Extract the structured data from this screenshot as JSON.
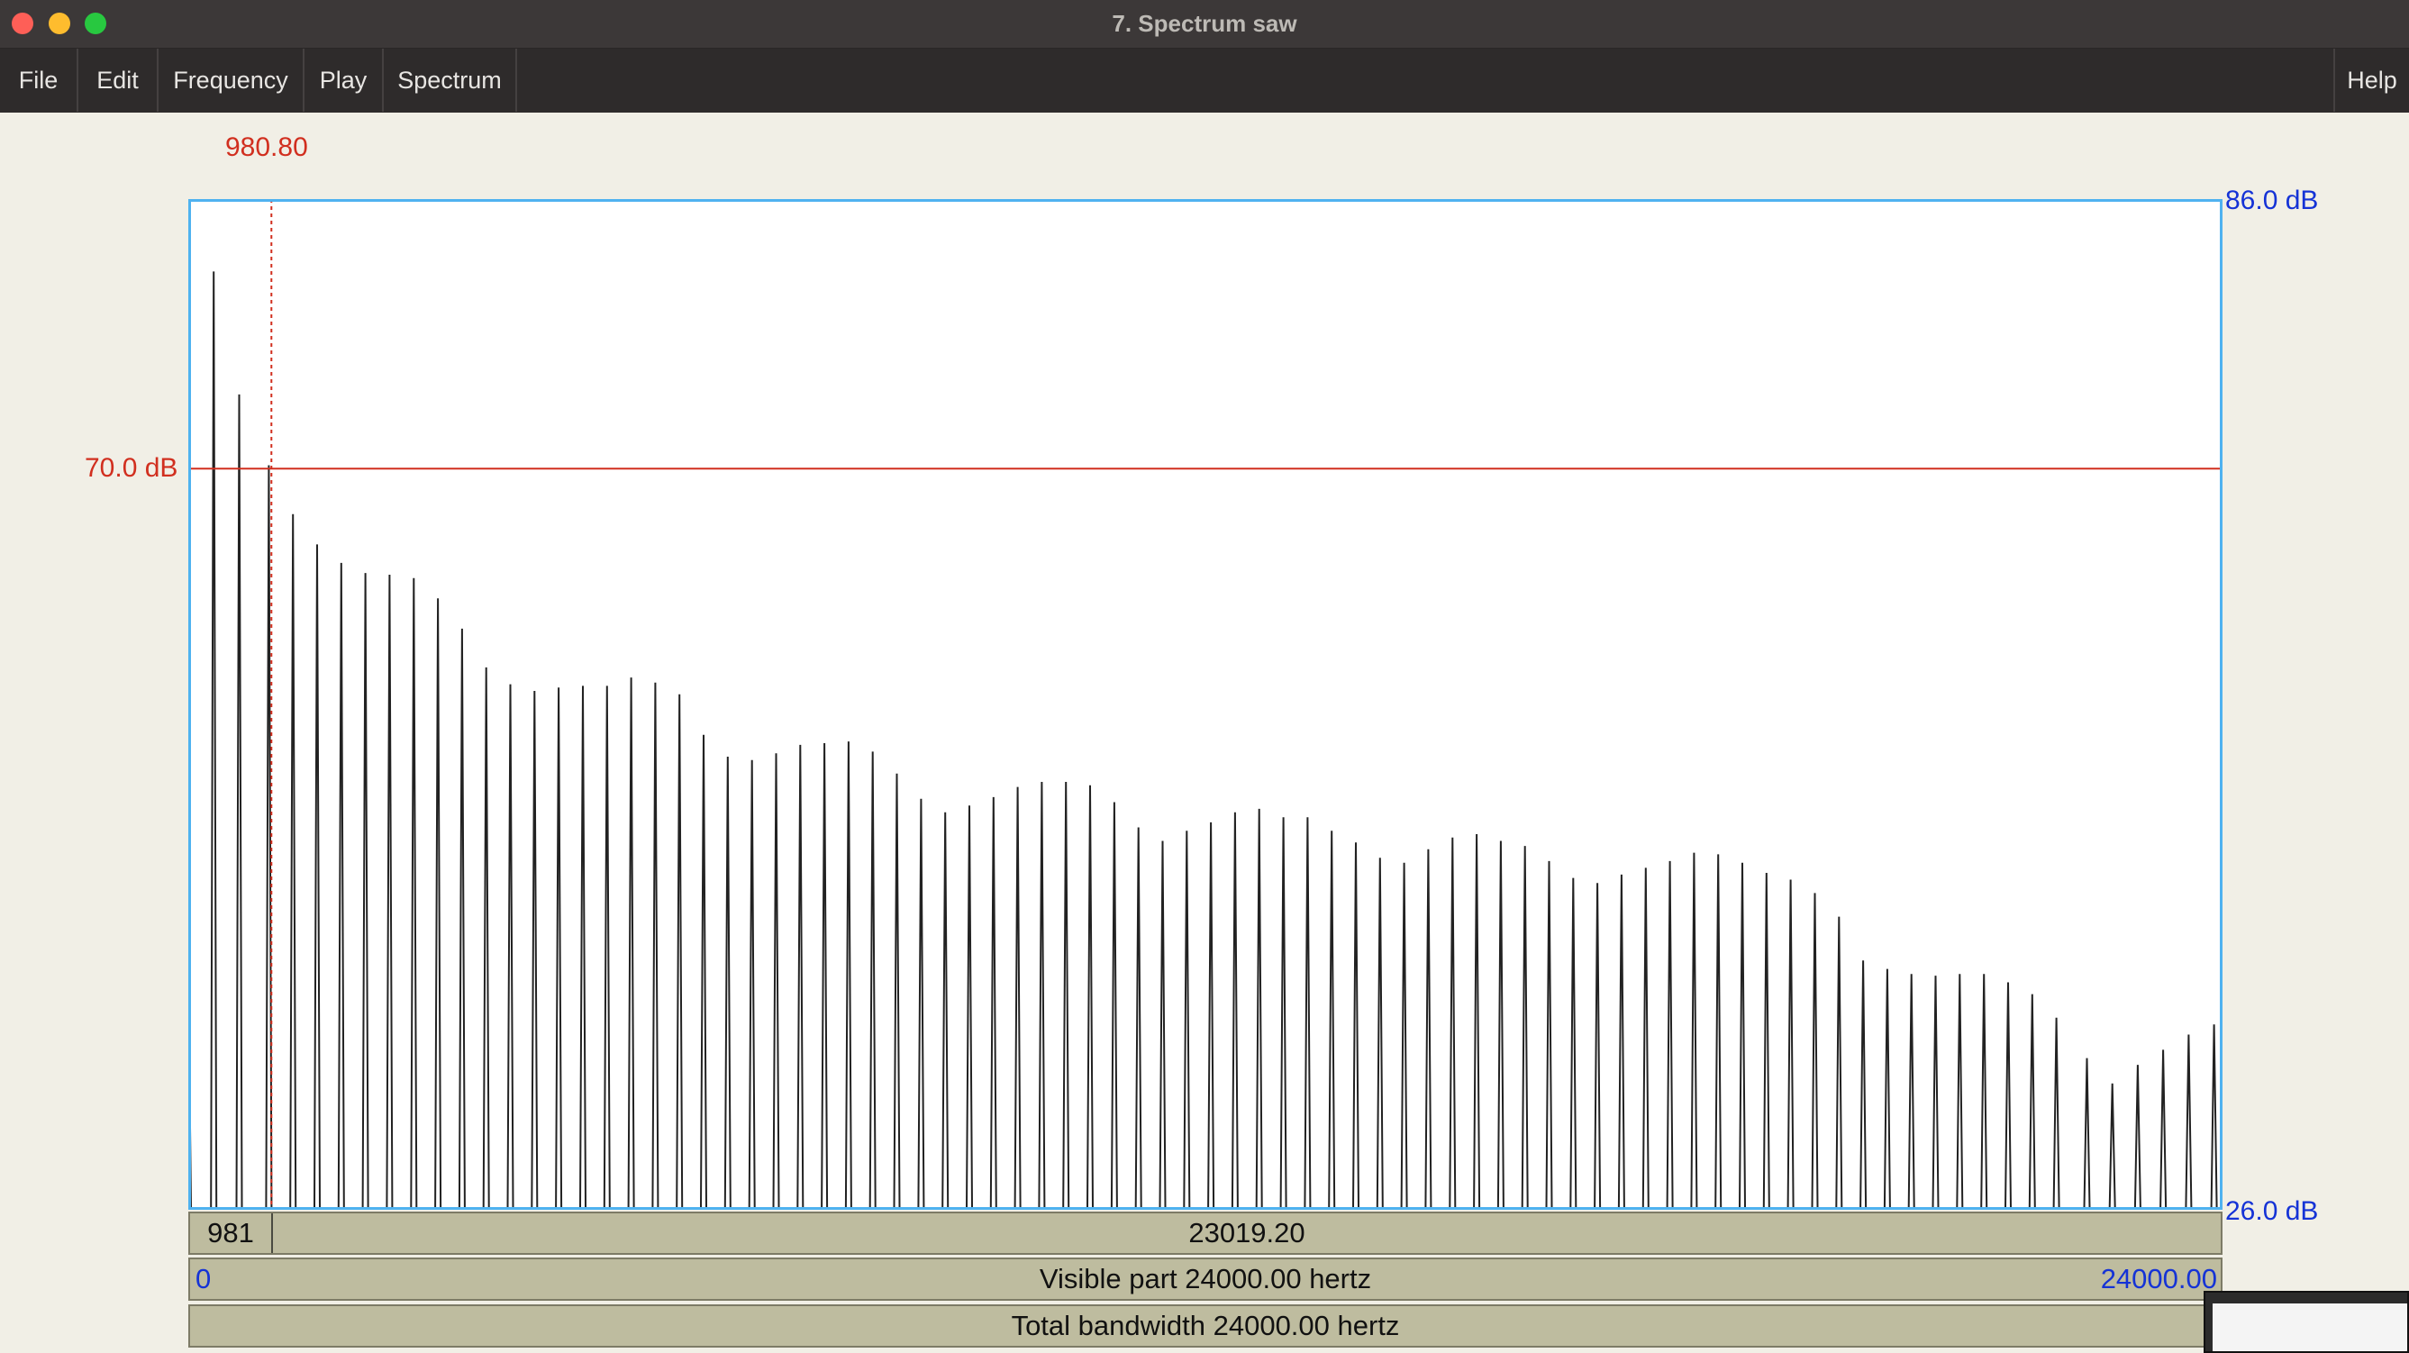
{
  "window": {
    "title": "7. Spectrum saw"
  },
  "menu": {
    "file": "File",
    "edit": "Edit",
    "frequency": "Frequency",
    "play": "Play",
    "spectrum": "Spectrum",
    "help": "Help"
  },
  "cursor": {
    "frequency_label": "980.80",
    "level_label": "70.0 dB",
    "frequency": 980.8,
    "level_db": 70.0,
    "color": "#d12f1f"
  },
  "axis": {
    "top_db_label": "86.0 dB",
    "bottom_db_label": "26.0 dB",
    "left_hz_label": "0",
    "right_hz_label": "24000.00",
    "color": "#1533d6"
  },
  "selection": {
    "left_label": "981",
    "right_label": "23019.20"
  },
  "visible_part": "Visible part 24000.00 hertz",
  "total_bandwidth": "Total bandwidth 24000.00 hertz",
  "chart_data": {
    "type": "line",
    "x_unit": "Hz",
    "y_unit": "dB",
    "xlim": [
      0,
      24000
    ],
    "ylim": [
      26.0,
      86.0
    ],
    "grid": false,
    "series": [
      {
        "color": "#222222",
        "x": [
          0,
          300,
          600,
          950,
          1235,
          1520,
          1805,
          2090,
          2375,
          2660,
          2945,
          3230,
          3515,
          3800,
          4085,
          4370,
          4655,
          4940,
          5225,
          5510,
          5795,
          6080,
          6365,
          6650,
          6935,
          7220,
          7505,
          7790,
          8075,
          8360,
          8645,
          8930,
          9215,
          9500,
          9785,
          10070,
          10355,
          10640,
          10925,
          11210,
          11495,
          11780,
          12065,
          12350,
          12635,
          12920,
          13205,
          13490,
          13775,
          14060,
          14345,
          14630,
          14915,
          15200,
          15485,
          15770,
          16055,
          16340,
          16625,
          16910,
          17195,
          17480,
          17765,
          18050,
          18335,
          18620,
          18905,
          19190,
          19475,
          19760,
          20045,
          20330,
          20615,
          20900,
          21185,
          21470,
          21755,
          22040,
          22400,
          22700,
          23000,
          23300,
          23600,
          23900
        ],
        "y": [
          40.5,
          81.7,
          74.4,
          70.2,
          67.3,
          65.5,
          64.4,
          63.8,
          63.7,
          63.5,
          62.3,
          60.5,
          58.2,
          57.2,
          56.8,
          57.0,
          57.1,
          57.1,
          57.6,
          57.3,
          56.6,
          54.2,
          52.9,
          52.7,
          53.1,
          53.6,
          53.7,
          53.8,
          53.2,
          51.9,
          50.4,
          49.6,
          50.0,
          50.5,
          51.1,
          51.4,
          51.4,
          51.2,
          50.2,
          48.7,
          47.9,
          48.5,
          49.0,
          49.6,
          49.8,
          49.3,
          49.3,
          48.5,
          47.8,
          46.9,
          46.6,
          47.4,
          48.1,
          48.3,
          47.9,
          47.6,
          46.7,
          45.7,
          45.4,
          45.9,
          46.3,
          46.7,
          47.2,
          47.1,
          46.6,
          46.0,
          45.6,
          44.8,
          43.4,
          40.8,
          40.3,
          40.0,
          39.9,
          40.0,
          40.0,
          39.5,
          38.8,
          37.4,
          35.0,
          33.5,
          34.6,
          35.5,
          36.4,
          37.0
        ]
      }
    ]
  }
}
